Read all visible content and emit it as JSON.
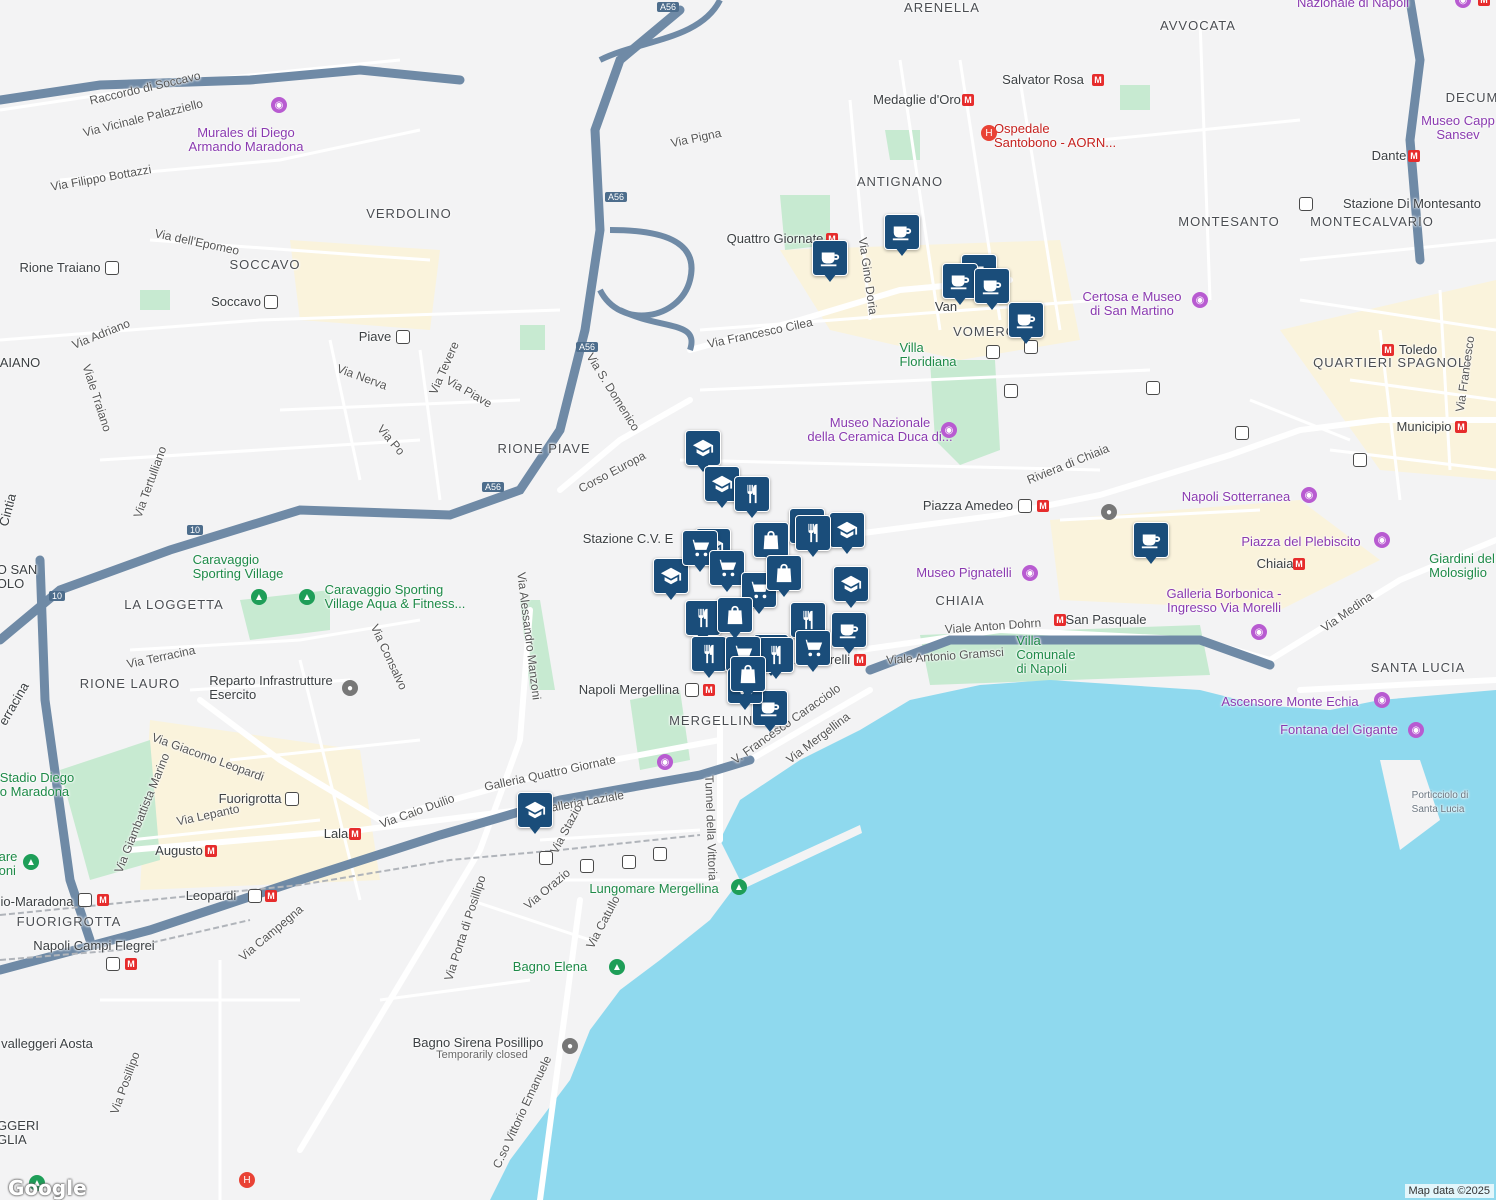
{
  "attribution": "Map data ©2025",
  "logo": "Google",
  "district_labels": [
    "ARENELLA",
    "AVVOCATA",
    "ANTIGNANO",
    "VERDOLINO",
    "SOCCAVO",
    "MONTESANTO",
    "MONTECALVARIO",
    "QUARTIERI SPAGNOLI",
    "RIONE PIAVE",
    "LA LOGGETTA",
    "RIONE LAURO",
    "CHIAIA",
    "SANTA LUCIA",
    "MERGELLINA",
    "FUORIGROTTA",
    "VOMERO",
    "DECUM"
  ],
  "road_labels": [
    "Raccordo di Soccavo",
    "Via Vicinale Palazziello",
    "Via Filippo Bottazzi",
    "Via dell'Epomeo",
    "Via Pigna",
    "Via Francesco Cilea",
    "Via Gino Doria",
    "Corso Europa",
    "Via S. Domenico",
    "Viale Traiano",
    "Via Adriano",
    "Via Nerva",
    "Via Tevere",
    "Via Piave",
    "Via Po",
    "Via Tertulliano",
    "Via Terracina",
    "Via Consalvo",
    "Via Alessandro Manzoni",
    "Via Giacomo Leopardi",
    "Via Giambattista Marino",
    "Via Lepanto",
    "Galleria Quattro Giornate",
    "Via Caio Duilio",
    "Galleria Laziale",
    "Via Stazio",
    "Via Orazio",
    "Via Catullo",
    "Via Porta di Posillipo",
    "Via Campegna",
    "Via Posillipo",
    "C.so Vittorio Emanuele",
    "Riviera di Chiaia",
    "Viale Anton Dohrn",
    "Viale Antonio Gramsci",
    "V. Francesco Caracciolo",
    "Via Mergellina",
    "Tunnel della Vittoria",
    "Via Medina",
    "Via Francesco"
  ],
  "place_labels": {
    "murales": "Murales di Diego\nArmando Maradona",
    "salvator_rosa": "Salvator Rosa",
    "medaglie": "Medaglie d'Oro",
    "ospedale": "Ospedale\nSantobono - AORN...",
    "quattro_giornate": "Quattro Giornate",
    "rione_traiano": "Rione Traiano",
    "soccavo_st": "Soccavo",
    "piave_st": "Piave",
    "certosa": "Certosa e Museo\ndi San Martino",
    "stazione_montesanto": "Stazione Di Montesanto",
    "dante": "Dante",
    "toledo": "Toledo",
    "municipio": "Municipio",
    "villa_floridiana": "Villa\nFloridiana",
    "museo_ceramica": "Museo Nazionale\ndella Ceramica Duca di...",
    "piazza_amedeo": "Piazza Amedeo",
    "napoli_sotterranea": "Napoli Sotterranea",
    "piazza_plebiscito": "Piazza del Plebiscito",
    "chiaia_st": "Chiaia",
    "giardini": "Giardini del\nMolosiglio",
    "galleria_borbonica": "Galleria Borbonica -\nIngresso Via Morelli",
    "museo_pignatelli": "Museo Pignatelli",
    "san_pasquale": "San Pasquale",
    "villa_comunale": "Villa\nComunale\ndi Napoli",
    "arco_mirelli": "Arco Mirelli",
    "ascensore": "Ascensore Monte Echia",
    "fontana": "Fontana del Gigante",
    "porticciolo": "Porticciolo di\nSanta Lucia",
    "stazione_cv": "Stazione C.V. E",
    "napoli_mergellina": "Napoli Mergellina",
    "caravaggio_sv": "Caravaggio\nSporting Village",
    "caravaggio_aqua": "Caravaggio Sporting\nVillage Aqua & Fitness...",
    "reparto": "Reparto Infrastrutture\nEsercito",
    "stadio": "Stadio Diego\no Maradona",
    "fuorigrotta_st": "Fuorigrotta",
    "lala": "Lala",
    "augusto": "Augusto",
    "leopardi": "Leopardi",
    "campi_flegrei": "Napoli Campi Flegrei",
    "mostra": "io-Maradona",
    "lungomare": "Lungomare Mergellina",
    "bagno_elena": "Bagno Elena",
    "bagno_sirena": "Bagno Sirena Posillipo",
    "temporarily_closed": "Temporarily closed",
    "cavalleggeri": "valleggeri Aosta",
    "san_paolo": "O SAN\nOLO",
    "aiano": "AIANO",
    "cintia": "Cintia",
    "errac": "erracina",
    "are": "are\noni",
    "ggeri": "GGERI\nGLIA",
    "museo_capp": "Museo Capp\nSansev",
    "nazionale": "Nazionale di Napoli",
    "vanvitelli": "Van"
  },
  "highway_shields": [
    "A56",
    "A56",
    "A56",
    "A56",
    "10",
    "10"
  ],
  "markers": [
    {
      "type": "cafe"
    },
    {
      "type": "cafe"
    },
    {
      "type": "cafe"
    },
    {
      "type": "cafe"
    },
    {
      "type": "cafe"
    },
    {
      "type": "cafe"
    },
    {
      "type": "cafe"
    },
    {
      "type": "cafe"
    },
    {
      "type": "cafe"
    },
    {
      "type": "school"
    },
    {
      "type": "school"
    },
    {
      "type": "school"
    },
    {
      "type": "school"
    },
    {
      "type": "school"
    },
    {
      "type": "school"
    },
    {
      "type": "school"
    },
    {
      "type": "restaurant"
    },
    {
      "type": "restaurant"
    },
    {
      "type": "restaurant"
    },
    {
      "type": "restaurant"
    },
    {
      "type": "restaurant"
    },
    {
      "type": "restaurant"
    },
    {
      "type": "restaurant"
    },
    {
      "type": "restaurant"
    },
    {
      "type": "grocery"
    },
    {
      "type": "grocery"
    },
    {
      "type": "grocery"
    },
    {
      "type": "grocery"
    },
    {
      "type": "grocery"
    },
    {
      "type": "grocery"
    },
    {
      "type": "shopping"
    },
    {
      "type": "shopping"
    },
    {
      "type": "shopping"
    },
    {
      "type": "shopping"
    }
  ],
  "colors": {
    "water": "#8fd9ee",
    "land": "#f3f3f4",
    "park": "#c4ebd0",
    "highway": "#6f8aa6",
    "road": "#ffffff",
    "marker": "#1a4d7a",
    "urban": "#f8f0d8"
  }
}
